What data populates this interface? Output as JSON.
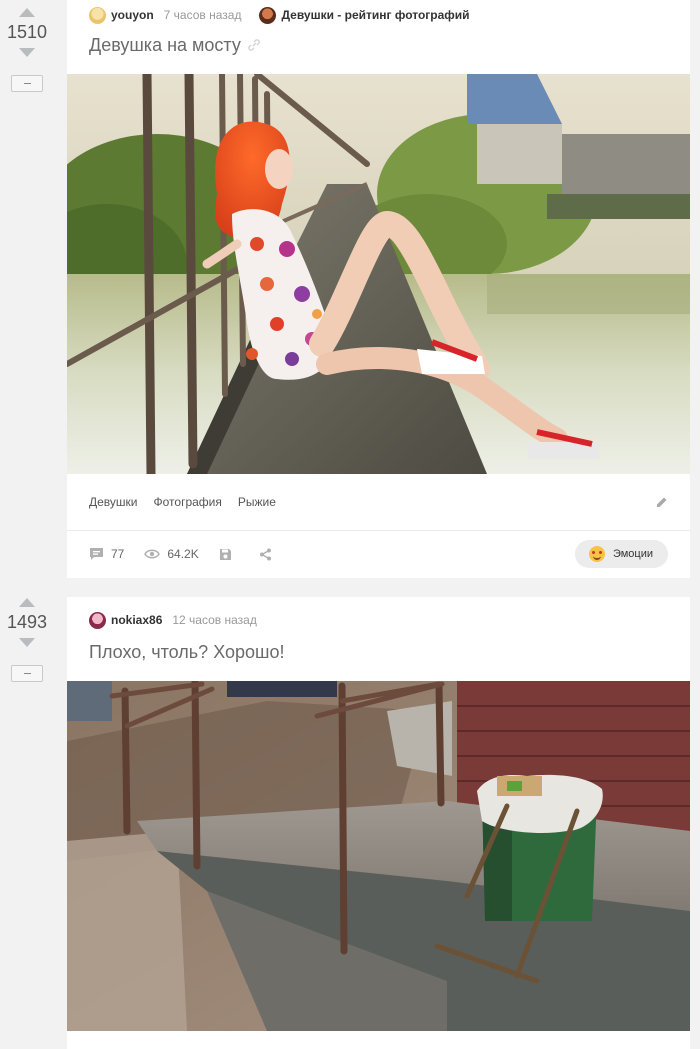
{
  "posts": [
    {
      "rating": "1510",
      "author": "youyon",
      "time": "7 часов назад",
      "community": "Девушки - рейтинг фотографий",
      "title": "Девушка на мосту",
      "tags": [
        "Девушки",
        "Фотография",
        "Рыжие"
      ],
      "comments": "77",
      "views": "64.2K",
      "emotions_label": "Эмоции",
      "image_icon": "photo-woman-on-bridge"
    },
    {
      "rating": "1493",
      "author": "nokiax86",
      "time": "12 часов назад",
      "title": "Плохо, чтоль? Хорошо!",
      "image_icon": "photo-trash-bin-on-steps"
    }
  ],
  "colors": {
    "background": "#f2f2f2",
    "card": "#ffffff",
    "arrow": "#b9bcbe",
    "muted_text": "#999999"
  }
}
